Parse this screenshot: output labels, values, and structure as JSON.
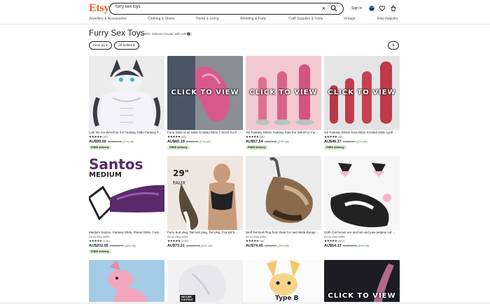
{
  "header": {
    "logo": "Etsy",
    "search_value": "furry sex toys",
    "signin": "Sign in"
  },
  "nav": [
    "Jewellery & Accessories",
    "Clothing & Shoes",
    "Home & Living",
    "Wedding & Party",
    "Craft Supplies & Tools",
    "Vintage",
    "Etsy Registry"
  ],
  "page": {
    "title": "Furry Sex Toys",
    "results": "(1,000+ relevant results, with Ads",
    "filters": [
      "Price (£) ▾",
      "All Sellers ▾"
    ],
    "sort_icon": "⇅"
  },
  "overlay_text": "CLICK TO VIEW",
  "products": [
    {
      "name": "Loki the Ice WereFox Xxl Fantasy Dildo Fantasy F...",
      "stars": "★★★★★",
      "reviews": "(38)",
      "price": "AU$99.56",
      "orig": "AU$136.38",
      "pct": "(27% off)",
      "free": "FREE delivery"
    },
    {
      "name": "Furry Dildo Knot Dildo Knotted Dildo 2 Sizes Xxl F...",
      "stars": "★★★★★",
      "reviews": "(53)",
      "price": "AU$60.19",
      "orig": "AU$82.45",
      "pct": "(27% off)",
      "free": "FREE delivery"
    },
    {
      "name": "Xxl Fantasy Dildos Fantasy Kibe the WereFox Fur...",
      "stars": "★★★★★",
      "reviews": "(38)",
      "price": "AU$57.54",
      "orig": "AU$78.82",
      "pct": "(27% off)",
      "free": "FREE delivery"
    },
    {
      "name": "Xxl Fantasy Dildos Knot Dildo Knotted Dildo Lyall ...",
      "stars": "★★★★★",
      "reviews": "(38)",
      "price": "AU$48.37",
      "orig": "AU$66.27",
      "pct": "(27% off)",
      "free": "FREE delivery"
    },
    {
      "name": "Medium Santos, Fantasy Dildo, Flared Dildo, Cust...",
      "seller": "Ad by Etsy seller",
      "stars": "★★★★★",
      "reviews": "(1.9k)",
      "price": "AU$202.95",
      "orig": "AU$238.77",
      "pct": "(15% off)",
      "free": "FREE delivery"
    },
    {
      "name": "Furry butt plug, Tail butt plug, Tail plug, Fox tail b...",
      "seller": "Ad by Etsy seller",
      "stars": "★★★★★",
      "reviews": "(2.5k)",
      "price": "AU$73.21",
      "orig": "AU$122.02",
      "pct": "(40% off)"
    },
    {
      "name": "Wolf Tail Butt Plug from Real Fur and Wide Range ...",
      "seller": "Ad by Etsy seller",
      "stars": "★★★★★",
      "reviews": "(1k)",
      "price": "AU$74.45",
      "orig": "AU$99.27",
      "pct": "(25% off)"
    },
    {
      "name": "Goth Cat fursuit ear and tail and paw petplay cat ...",
      "seller": "Ad by Etsy seller",
      "stars": "★★★★★",
      "reviews": "(821)",
      "price": "AU$54.17",
      "orig": "AU$108.33",
      "pct": "(50% off)"
    },
    {
      "name": ""
    },
    {
      "name": ""
    },
    {
      "name": ""
    },
    {
      "name": ""
    }
  ],
  "watermarks": {
    "santos": "Santos",
    "medium": "MEDIUM",
    "p29": "29\"",
    "faux": "FAUX",
    "typeb": "Type B",
    "mature": "MATURE CONTENT"
  },
  "colors": {
    "brand": "#f1641e",
    "free_bg": "#d4e9c9",
    "discount": "#2c7b2c"
  }
}
